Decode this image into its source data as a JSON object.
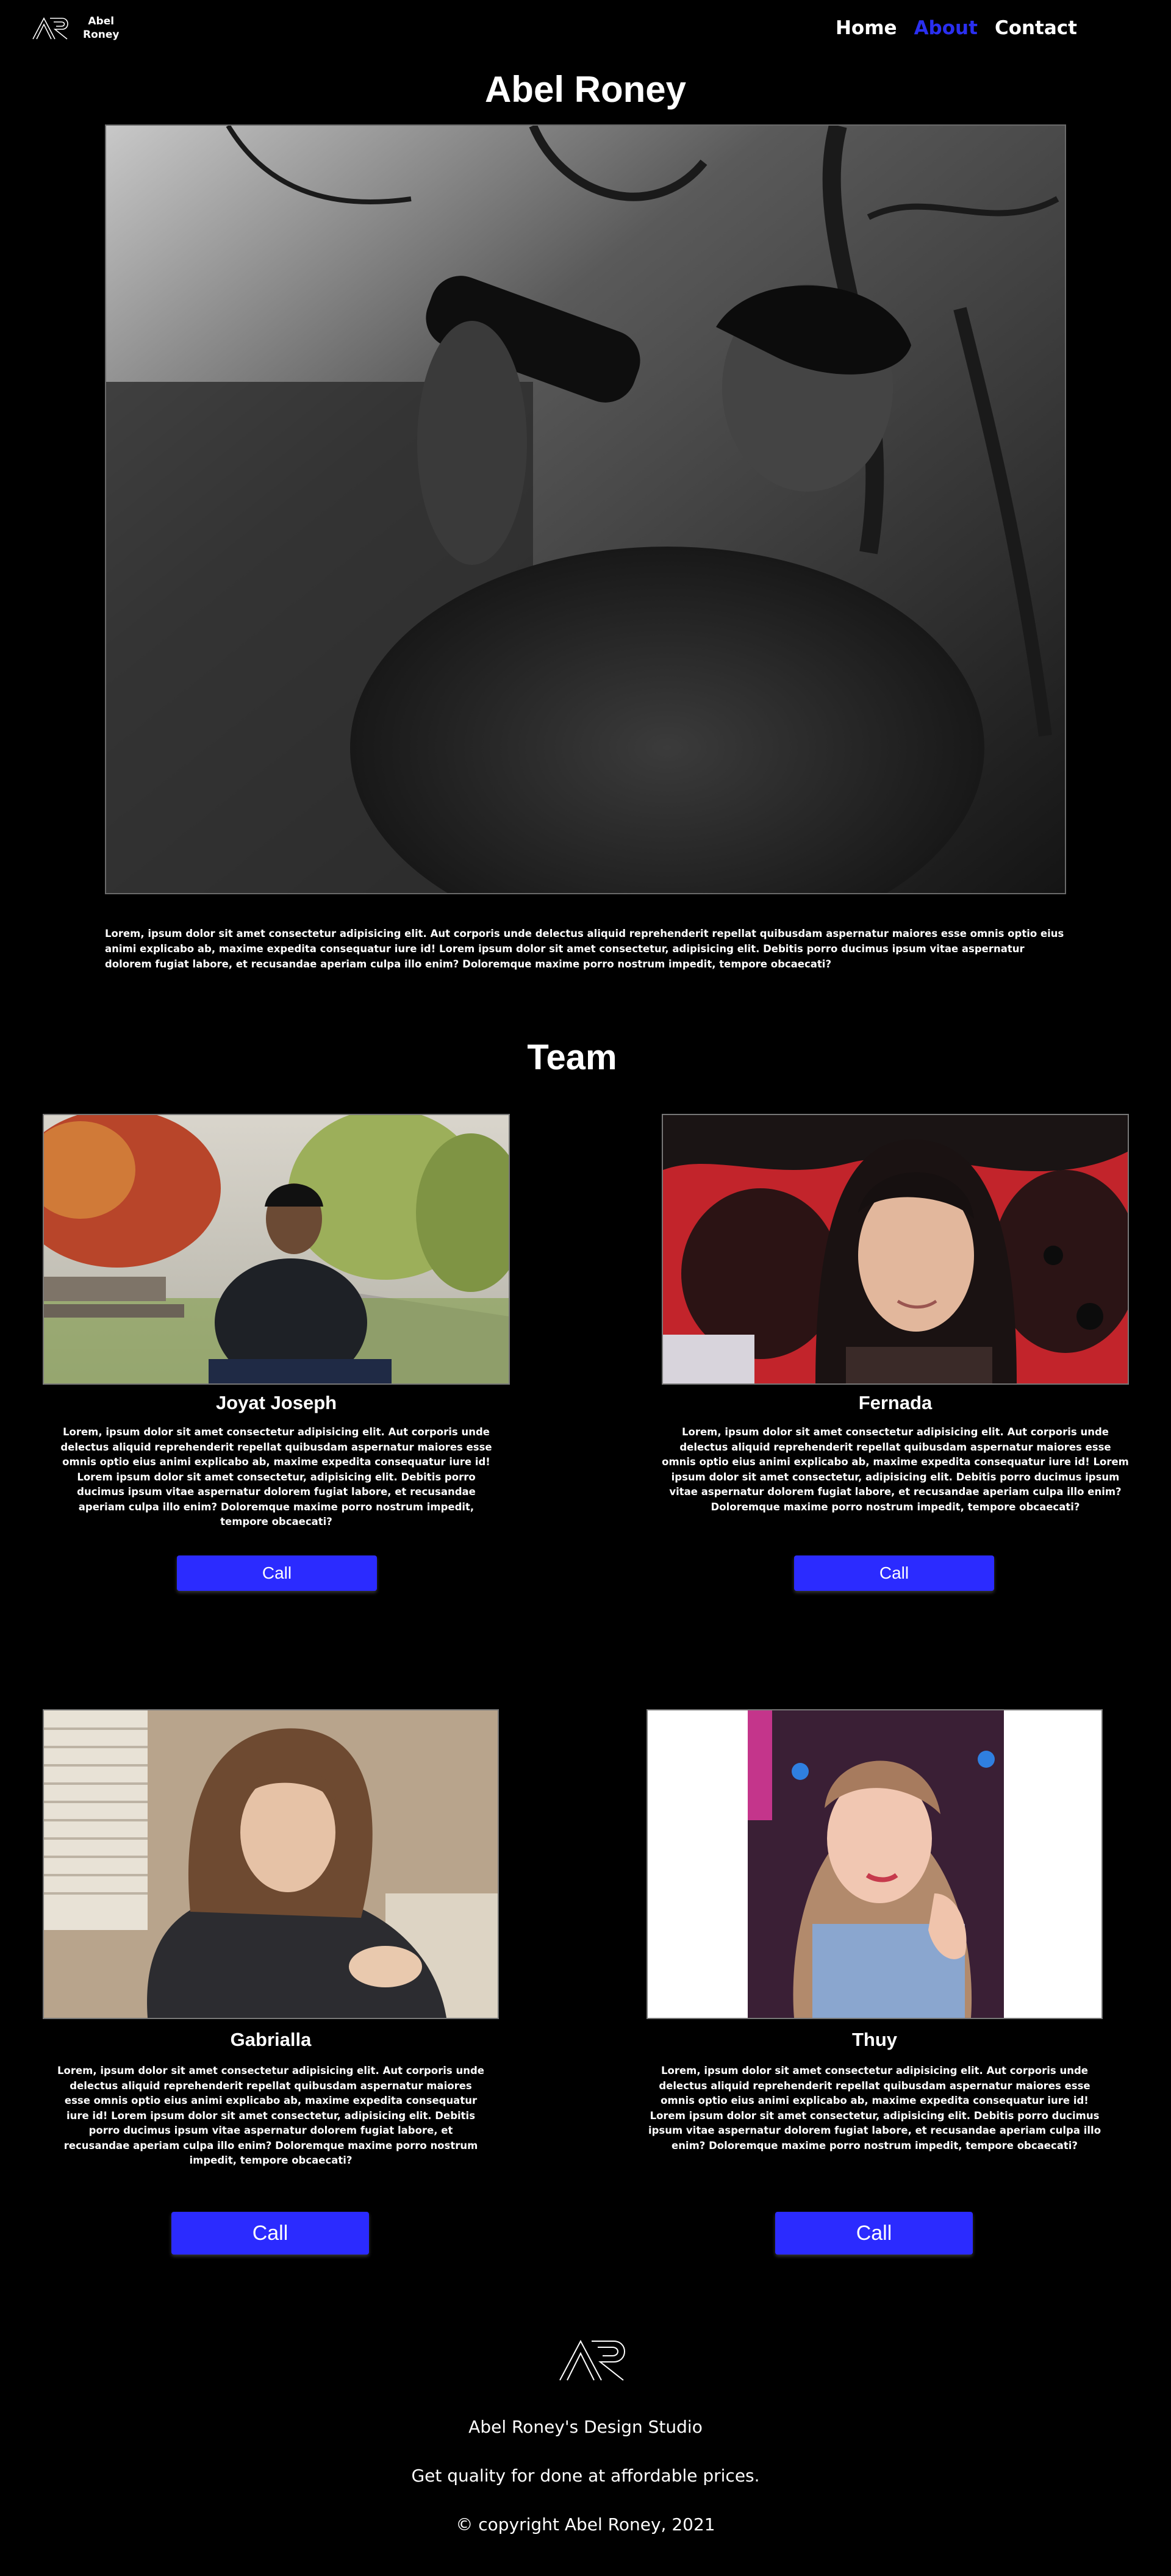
{
  "header": {
    "logo_line1": "Abel",
    "logo_line2": "Roney",
    "nav": [
      {
        "label": "Home"
      },
      {
        "label": "About"
      },
      {
        "label": "Contact"
      }
    ]
  },
  "hero": {
    "title": "Abel Roney",
    "text": "Lorem, ipsum dolor sit amet consectetur adipisicing elit. Aut corporis unde delectus aliquid reprehenderit repellat quibusdam aspernatur maiores esse omnis optio eius animi explicabo ab, maxime expedita consequatur iure id! Lorem ipsum dolor sit amet consectetur, adipisicing elit. Debitis porro ducimus ipsum vitae aspernatur dolorem fugiat labore, et recusandae aperiam culpa illo enim? Doloremque maxime porro nostrum impedit, tempore obcaecati?"
  },
  "team": {
    "title": "Team",
    "members": [
      {
        "name": "Joyat Joseph",
        "text": "Lorem, ipsum dolor sit amet consectetur adipisicing elit. Aut corporis unde delectus aliquid reprehenderit repellat quibusdam aspernatur maiores esse omnis optio eius animi explicabo ab, maxime expedita consequatur iure id! Lorem ipsum dolor sit amet consectetur, adipisicing elit. Debitis porro ducimus ipsum vitae aspernatur dolorem fugiat labore, et recusandae aperiam culpa illo enim? Doloremque maxime porro nostrum impedit, tempore obcaecati?",
        "button": "Call"
      },
      {
        "name": "Fernada",
        "text": "Lorem, ipsum dolor sit amet consectetur adipisicing elit. Aut corporis unde delectus aliquid reprehenderit repellat quibusdam aspernatur maiores esse omnis optio eius animi explicabo ab, maxime expedita consequatur iure id! Lorem ipsum dolor sit amet consectetur, adipisicing elit. Debitis porro ducimus ipsum vitae aspernatur dolorem fugiat labore, et recusandae aperiam culpa illo enim? Doloremque maxime porro nostrum impedit, tempore obcaecati?",
        "button": "Call"
      },
      {
        "name": "Gabrialla",
        "text": "Lorem, ipsum dolor sit amet consectetur adipisicing elit. Aut corporis unde delectus aliquid reprehenderit repellat quibusdam aspernatur maiores esse omnis optio eius animi explicabo ab, maxime expedita consequatur iure id! Lorem ipsum dolor sit amet consectetur, adipisicing elit. Debitis porro ducimus ipsum vitae aspernatur dolorem fugiat labore, et recusandae aperiam culpa illo enim? Doloremque maxime porro nostrum impedit, tempore obcaecati?",
        "button": "Call"
      },
      {
        "name": "Thuy",
        "text": "Lorem, ipsum dolor sit amet consectetur adipisicing elit. Aut corporis unde delectus aliquid reprehenderit repellat quibusdam aspernatur maiores esse omnis optio eius animi explicabo ab, maxime expedita consequatur iure id! Lorem ipsum dolor sit amet consectetur, adipisicing elit. Debitis porro ducimus ipsum vitae aspernatur dolorem fugiat labore, et recusandae aperiam culpa illo enim? Doloremque maxime porro nostrum impedit, tempore obcaecati?",
        "button": "Call"
      }
    ]
  },
  "footer": {
    "studio": "Abel Roney's Design Studio",
    "tagline": "Get quality for done at affordable prices.",
    "copyright": "© copyright Abel Roney, 2021"
  },
  "colors": {
    "background": "#000000",
    "accent": "#2b2bff",
    "nav_active": "#2a2ff0"
  },
  "icons": [
    "ar-logo-icon"
  ]
}
